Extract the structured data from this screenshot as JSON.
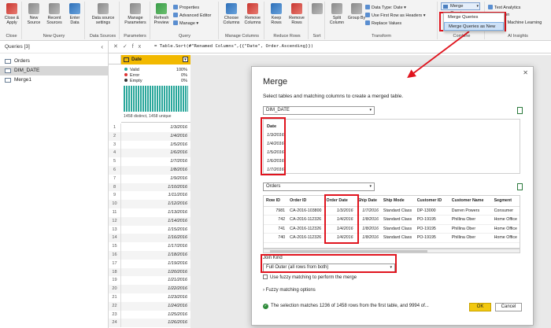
{
  "ribbon": {
    "close_apply": "Close & Apply",
    "new_source": "New Source",
    "recent_sources": "Recent Sources",
    "enter_data": "Enter Data",
    "data_source_settings": "Data source settings",
    "manage_parameters": "Manage Parameters",
    "refresh_preview": "Refresh Preview",
    "properties": "Properties",
    "advanced_editor": "Advanced Editor",
    "manage": "Manage",
    "choose_columns": "Choose Columns",
    "remove_columns": "Remove Columns",
    "keep_rows": "Keep Rows",
    "remove_rows": "Remove Rows",
    "split_column": "Split Column",
    "group_by": "Group By",
    "data_type": "Data Type: Date",
    "use_first_row": "Use First Row as Headers",
    "replace_values": "Replace Values",
    "merge_queries": "Merge Queries",
    "text_analytics": "Text Analytics",
    "vision_partial": "ion",
    "azure_ml_partial": "e Machine Learning",
    "groups": {
      "close": "Close",
      "new_query": "New Query",
      "data_sources": "Data Sources",
      "parameters": "Parameters",
      "query": "Query",
      "manage_columns": "Manage Columns",
      "reduce_rows": "Reduce Rows",
      "sort": "Sort",
      "transform": "Transform",
      "combine": "Combine",
      "ai_insights": "AI Insights"
    },
    "merge_dropdown": [
      "Merge Queries",
      "Merge Queries as New"
    ]
  },
  "queries": {
    "header": "Queries [3]",
    "items": [
      "Orders",
      "DIM_DATE",
      "Merge1"
    ]
  },
  "formula": {
    "fx": "fx",
    "text": "= Table.Sort(#\"Renamed Columns\",{{\"Date\", Order.Ascending}})"
  },
  "grid": {
    "column": "Date",
    "profile": [
      {
        "label": "Valid",
        "value": "100%",
        "color": "#2aa79b"
      },
      {
        "label": "Error",
        "value": "0%",
        "color": "#d33"
      },
      {
        "label": "Empty",
        "value": "0%",
        "color": "#333"
      }
    ],
    "distinct": "1458 distinct, 1458 unique",
    "rows": [
      {
        "n": "1",
        "v": "1/3/2016"
      },
      {
        "n": "2",
        "v": "1/4/2016"
      },
      {
        "n": "3",
        "v": "1/5/2016"
      },
      {
        "n": "4",
        "v": "1/6/2016"
      },
      {
        "n": "5",
        "v": "1/7/2016"
      },
      {
        "n": "6",
        "v": "1/8/2016"
      },
      {
        "n": "7",
        "v": "1/9/2016"
      },
      {
        "n": "8",
        "v": "1/10/2016"
      },
      {
        "n": "9",
        "v": "1/11/2016"
      },
      {
        "n": "10",
        "v": "1/12/2016"
      },
      {
        "n": "11",
        "v": "1/13/2016"
      },
      {
        "n": "12",
        "v": "1/14/2016"
      },
      {
        "n": "13",
        "v": "1/15/2016"
      },
      {
        "n": "14",
        "v": "1/16/2016"
      },
      {
        "n": "15",
        "v": "1/17/2016"
      },
      {
        "n": "16",
        "v": "1/18/2016"
      },
      {
        "n": "17",
        "v": "1/19/2016"
      },
      {
        "n": "18",
        "v": "1/20/2016"
      },
      {
        "n": "19",
        "v": "1/21/2016"
      },
      {
        "n": "20",
        "v": "1/22/2016"
      },
      {
        "n": "21",
        "v": "1/23/2016"
      },
      {
        "n": "22",
        "v": "1/24/2016"
      },
      {
        "n": "23",
        "v": "1/25/2016"
      },
      {
        "n": "24",
        "v": "1/26/2016"
      }
    ]
  },
  "merge": {
    "title": "Merge",
    "subtitle": "Select tables and matching columns to create a merged table.",
    "table1": "DIM_DATE",
    "table1_header": "Date",
    "table1_rows": [
      "1/3/2016",
      "1/4/2016",
      "1/5/2016",
      "1/6/2016",
      "1/7/2016"
    ],
    "table2": "Orders",
    "table2_headers": [
      "Row ID",
      "Order ID",
      "Order Date",
      "Ship Date",
      "Ship Mode",
      "Customer ID",
      "Customer Name",
      "Segment"
    ],
    "table2_rows": [
      [
        "7981",
        "CA-2016-103800",
        "1/3/2016",
        "1/7/2016",
        "Standard Class",
        "DP-13000",
        "Darren Powers",
        "Consumer"
      ],
      [
        "742",
        "CA-2016-112326",
        "1/4/2016",
        "1/8/2016",
        "Standard Class",
        "PO-19195",
        "Phillina Ober",
        "Home Office"
      ],
      [
        "741",
        "CA-2016-112326",
        "1/4/2016",
        "1/8/2016",
        "Standard Class",
        "PO-19195",
        "Phillina Ober",
        "Home Office"
      ],
      [
        "740",
        "CA-2016-112326",
        "1/4/2016",
        "1/8/2016",
        "Standard Class",
        "PO-19195",
        "Phillina Ober",
        "Home Office"
      ]
    ],
    "join_kind_label": "Join Kind",
    "join_kind_value": "Full Outer (all rows from both)",
    "fuzzy_label": "Use fuzzy matching to perform the merge",
    "fuzzy_options": "Fuzzy matching options",
    "status": "The selection matches 1236 of 1458 rows from the first table, and 9994 of...",
    "ok": "OK",
    "cancel": "Cancel"
  }
}
